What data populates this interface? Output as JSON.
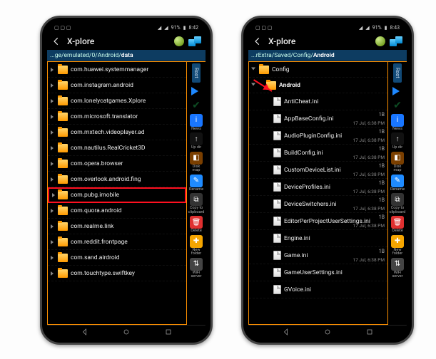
{
  "left": {
    "status": {
      "time": "8:42",
      "batt": "91%"
    },
    "title": "X-plore",
    "path_prefix": "...ge/emulated/0/Android/",
    "path_current": "data",
    "items": [
      {
        "name": "com.huawei.systemmanager"
      },
      {
        "name": "com.instagram.android"
      },
      {
        "name": "com.lonelycatgames.Xplore"
      },
      {
        "name": "com.microsoft.translator"
      },
      {
        "name": "com.mxtech.videoplayer.ad"
      },
      {
        "name": "com.nautilus.RealCricket3D"
      },
      {
        "name": "com.opera.browser"
      },
      {
        "name": "com.overlook.android.fing"
      },
      {
        "name": "com.pubg.imobile",
        "hl": true
      },
      {
        "name": "com.quora.android"
      },
      {
        "name": "com.realme.link"
      },
      {
        "name": "com.reddit.frontpage"
      },
      {
        "name": "com.sand.airdroid"
      },
      {
        "name": "com.touchtype.swiftkey"
      }
    ],
    "side": [
      {
        "lab": "News",
        "color": "#1976ff",
        "glyph": "i"
      },
      {
        "lab": "Up dir",
        "color": "#111",
        "glyph": "↑"
      },
      {
        "lab": "Disk map",
        "color": "#7a3f00",
        "glyph": "◧"
      },
      {
        "lab": "Rename",
        "color": "#1f8bff",
        "glyph": "✎"
      },
      {
        "lab": "Copy to clipboard",
        "color": "#333",
        "glyph": "⧉"
      },
      {
        "lab": "Delete",
        "color": "#e03030",
        "glyph": "🗑"
      },
      {
        "lab": "New folder",
        "color": "#f5a500",
        "glyph": "✚"
      },
      {
        "lab": "WiFi server",
        "color": "#444",
        "glyph": "⇅"
      }
    ],
    "root_label": "Root"
  },
  "right": {
    "status": {
      "time": "8:43",
      "batt": "91%"
    },
    "title": "X-plore",
    "path_prefix": "...rExtra/Saved/Config/",
    "path_current": "Android",
    "parent": {
      "name": "Config"
    },
    "current_folder": {
      "name": "Android"
    },
    "items": [
      {
        "name": "AntiCheat.ini",
        "date": "",
        "size": ""
      },
      {
        "name": "AppBaseConfig.ini",
        "date": "17 Jul, 6:38 PM",
        "size": "1B"
      },
      {
        "name": "AudioPluginConfig.ini",
        "date": "17 Jul, 6:38 PM",
        "size": "1B"
      },
      {
        "name": "BuildConfig.ini",
        "date": "17 Jul, 6:38 PM",
        "size": "1B"
      },
      {
        "name": "CustomDeviceList.ini",
        "date": "17 Jul, 6:38 PM",
        "size": "1B"
      },
      {
        "name": "DeviceProfiles.ini",
        "date": "17 Jul, 6:38 PM",
        "size": "1B"
      },
      {
        "name": "DeviceSwitchers.ini",
        "date": "17 Jul, 6:38 PM",
        "size": "1B"
      },
      {
        "name": "EditorPerProjectUserSettings.ini",
        "date": "17 Jul, 6:38 PM",
        "size": "1B"
      },
      {
        "name": "Engine.ini",
        "date": "",
        "size": ""
      },
      {
        "name": "Game.ini",
        "date": "17 Jul, 6:38 PM",
        "size": "1B"
      },
      {
        "name": "GameUserSettings.ini",
        "date": "",
        "size": ""
      },
      {
        "name": "GVoice.ini",
        "date": "",
        "size": ""
      }
    ],
    "side": [
      {
        "lab": "News",
        "color": "#1976ff",
        "glyph": "i"
      },
      {
        "lab": "Up dir",
        "color": "#111",
        "glyph": "↑"
      },
      {
        "lab": "Disk map",
        "color": "#7a3f00",
        "glyph": "◧"
      },
      {
        "lab": "Rename",
        "color": "#1f8bff",
        "glyph": "✎"
      },
      {
        "lab": "Copy to clipboard",
        "color": "#333",
        "glyph": "⧉"
      },
      {
        "lab": "Delete",
        "color": "#e03030",
        "glyph": "🗑"
      },
      {
        "lab": "New folder",
        "color": "#f5a500",
        "glyph": "✚"
      },
      {
        "lab": "WiFi server",
        "color": "#444",
        "glyph": "⇅"
      }
    ],
    "root_label": "Root"
  }
}
